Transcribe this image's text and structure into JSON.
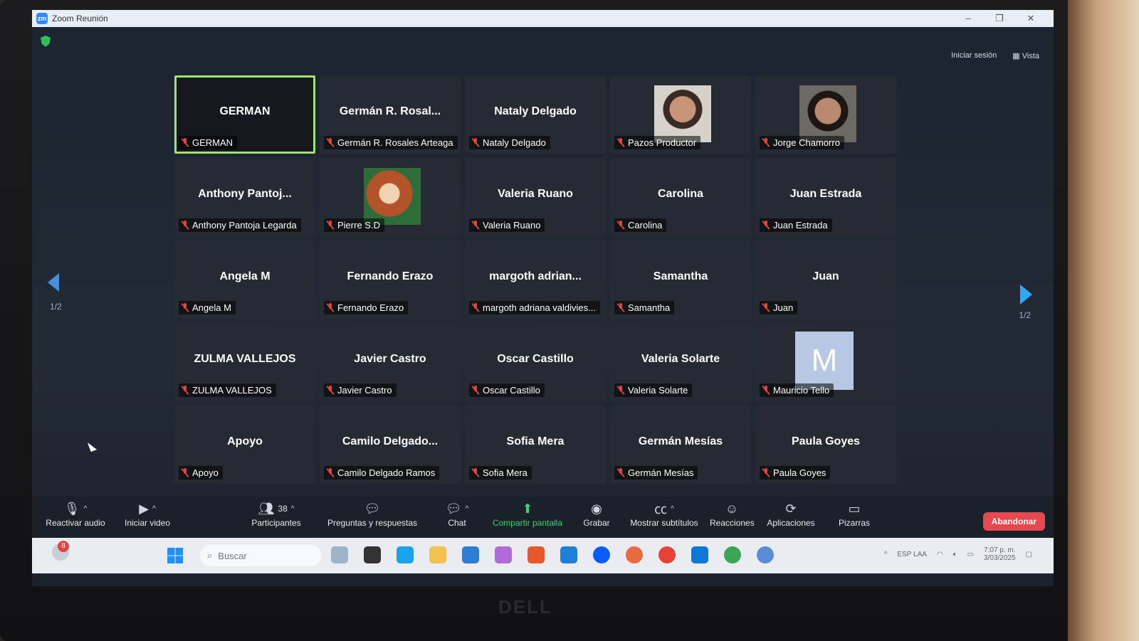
{
  "window": {
    "title": "Zoom Reunión",
    "controls": [
      "–",
      "❐",
      "✕"
    ]
  },
  "top_right": {
    "signin": "Iniciar sesión",
    "view": "Vista"
  },
  "pagination": {
    "left": "1/2",
    "right": "1/2"
  },
  "tiles": [
    {
      "big": "GERMAN",
      "label": "GERMAN",
      "active": true
    },
    {
      "big": "Germán R. Rosal...",
      "label": "Germán R. Rosales Arteaga"
    },
    {
      "big": "Nataly Delgado",
      "label": "Nataly Delgado"
    },
    {
      "big": "",
      "label": "Pazos Productor",
      "photo": "p1"
    },
    {
      "big": "",
      "label": "Jorge Chamorro",
      "photo": "p2"
    },
    {
      "big": "Anthony Pantoj...",
      "label": "Anthony Pantoja Legarda"
    },
    {
      "big": "",
      "label": "Pierre S.D",
      "photo": "p3"
    },
    {
      "big": "Valeria Ruano",
      "label": "Valeria Ruano"
    },
    {
      "big": "Carolina",
      "label": "Carolina"
    },
    {
      "big": "Juan Estrada",
      "label": "Juan Estrada"
    },
    {
      "big": "Angela M",
      "label": "Angela M"
    },
    {
      "big": "Fernando Erazo",
      "label": "Fernando Erazo"
    },
    {
      "big": "margoth adrian...",
      "label": "margoth adriana valdivies..."
    },
    {
      "big": "Samantha",
      "label": "Samantha"
    },
    {
      "big": "Juan",
      "label": "Juan"
    },
    {
      "big": "ZULMA VALLEJOS",
      "label": "ZULMA VALLEJOS"
    },
    {
      "big": "Javier Castro",
      "label": "Javier Castro"
    },
    {
      "big": "Oscar Castillo",
      "label": "Oscar Castillo"
    },
    {
      "big": "Valeria Solarte",
      "label": "Valeria Solarte"
    },
    {
      "big": "",
      "label": "Mauricio Tello",
      "avatar": "M"
    },
    {
      "big": "Apoyo",
      "label": "Apoyo"
    },
    {
      "big": "Camilo Delgado...",
      "label": "Camilo Delgado Ramos"
    },
    {
      "big": "Sofia Mera",
      "label": "Sofia Mera"
    },
    {
      "big": "Germán Mesías",
      "label": "Germán Mesías"
    },
    {
      "big": "Paula Goyes",
      "label": "Paula Goyes"
    }
  ],
  "toolbar": {
    "audio": "Reactivar audio",
    "video": "Iniciar video",
    "participants": "Participantes",
    "participants_count": "38",
    "qa": "Preguntas y respuestas",
    "chat": "Chat",
    "share": "Compartir pantalla",
    "record": "Grabar",
    "captions": "Mostrar subtítulos",
    "reactions": "Reacciones",
    "apps": "Aplicaciones",
    "whiteboards": "Pizarras",
    "leave": "Abandonar"
  },
  "taskbar": {
    "notification_count": "8",
    "search_placeholder": "Buscar",
    "lang": "ESP LAA",
    "time": "7:07 p. m.",
    "date": "3/03/2025"
  },
  "brand": "DELL"
}
